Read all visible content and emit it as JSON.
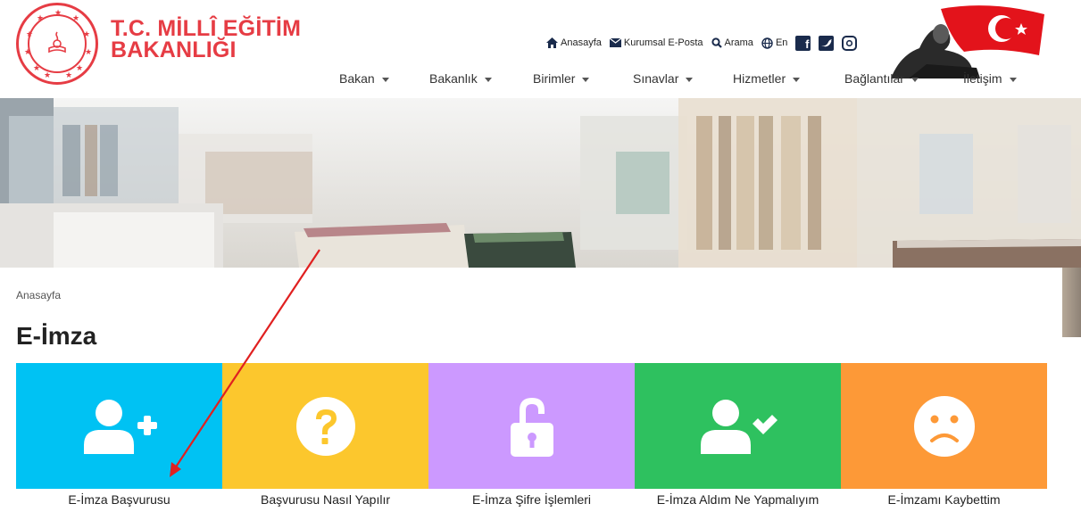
{
  "header": {
    "org_line1": "T.C. MİLLÎ EĞİTİM",
    "org_line2": "BAKANLIĞI",
    "top_links": [
      {
        "label": "Anasayfa",
        "icon": "home-icon"
      },
      {
        "label": "Kurumsal E-Posta",
        "icon": "envelope-icon"
      },
      {
        "label": "Arama",
        "icon": "search-icon"
      },
      {
        "label": "En",
        "icon": "globe-icon"
      }
    ],
    "social": [
      "facebook-icon",
      "twitter-icon",
      "instagram-icon"
    ],
    "brand_color": "#e63c44"
  },
  "nav": {
    "items": [
      "Bakan",
      "Bakanlık",
      "Birimler",
      "Sınavlar",
      "Hizmetler",
      "Bağlantılar",
      "İletişim"
    ]
  },
  "breadcrumb": "Anasayfa",
  "page_title": "E-İmza",
  "tiles": [
    {
      "label": "E-İmza Başvurusu",
      "icon": "add-user-icon",
      "color": "#00c2f3"
    },
    {
      "label": "Başvurusu Nasıl Yapılır",
      "icon": "question-icon",
      "color": "#fcc72d"
    },
    {
      "label": "E-İmza Şifre İşlemleri",
      "icon": "unlock-icon",
      "color": "#cc99ff"
    },
    {
      "label": "E-İmza Aldım Ne Yapmalıyım",
      "icon": "user-check-icon",
      "color": "#2ec15f"
    },
    {
      "label": "E-İmzamı Kaybettim",
      "icon": "sad-face-icon",
      "color": "#fd9937"
    }
  ],
  "annotation_color": "#e02020"
}
